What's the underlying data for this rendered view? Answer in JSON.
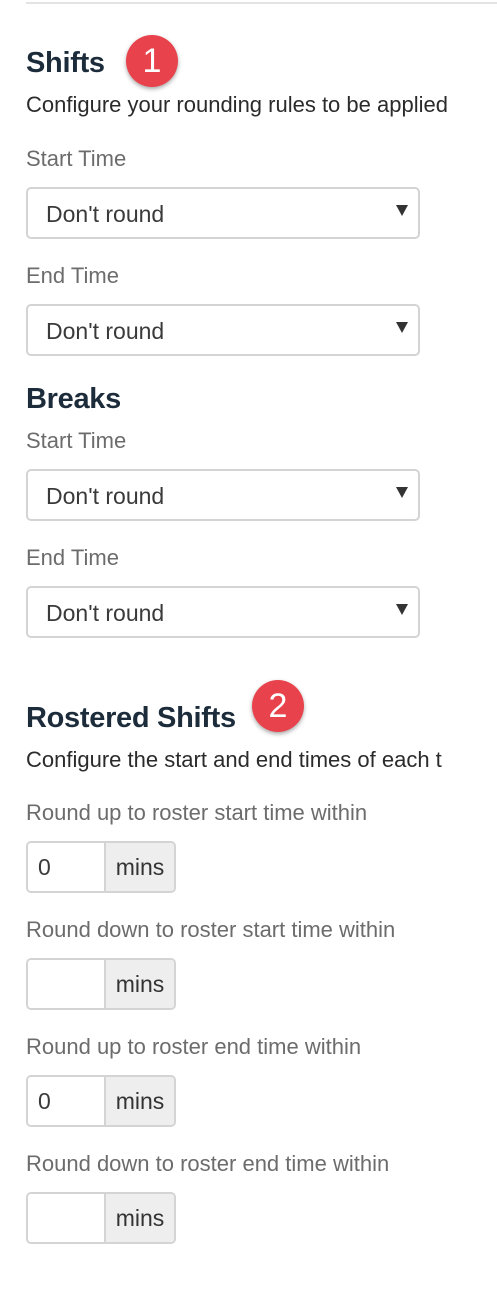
{
  "shifts": {
    "heading": "Shifts",
    "badge": "1",
    "description": "Configure your rounding rules to be applied",
    "start_time": {
      "label": "Start Time",
      "value": "Don't round"
    },
    "end_time": {
      "label": "End Time",
      "value": "Don't round"
    }
  },
  "breaks": {
    "heading": "Breaks",
    "start_time": {
      "label": "Start Time",
      "value": "Don't round"
    },
    "end_time": {
      "label": "End Time",
      "value": "Don't round"
    }
  },
  "rostered_shifts": {
    "heading": "Rostered Shifts",
    "badge": "2",
    "description": "Configure the start and end times of each t",
    "fields": [
      {
        "label": "Round up to roster start time within",
        "value": "0",
        "unit": "mins"
      },
      {
        "label": "Round down to roster start time within",
        "value": "",
        "unit": "mins"
      },
      {
        "label": "Round up to roster end time within",
        "value": "0",
        "unit": "mins"
      },
      {
        "label": "Round down to roster end time within",
        "value": "",
        "unit": "mins"
      }
    ]
  },
  "colors": {
    "badge": "#e8424c",
    "heading": "#1d2c3b",
    "label": "#6c6c6c",
    "border": "#d4d4d4",
    "addon_bg": "#eeeeee"
  },
  "icons": {
    "select_arrow": "caret-down-icon"
  }
}
